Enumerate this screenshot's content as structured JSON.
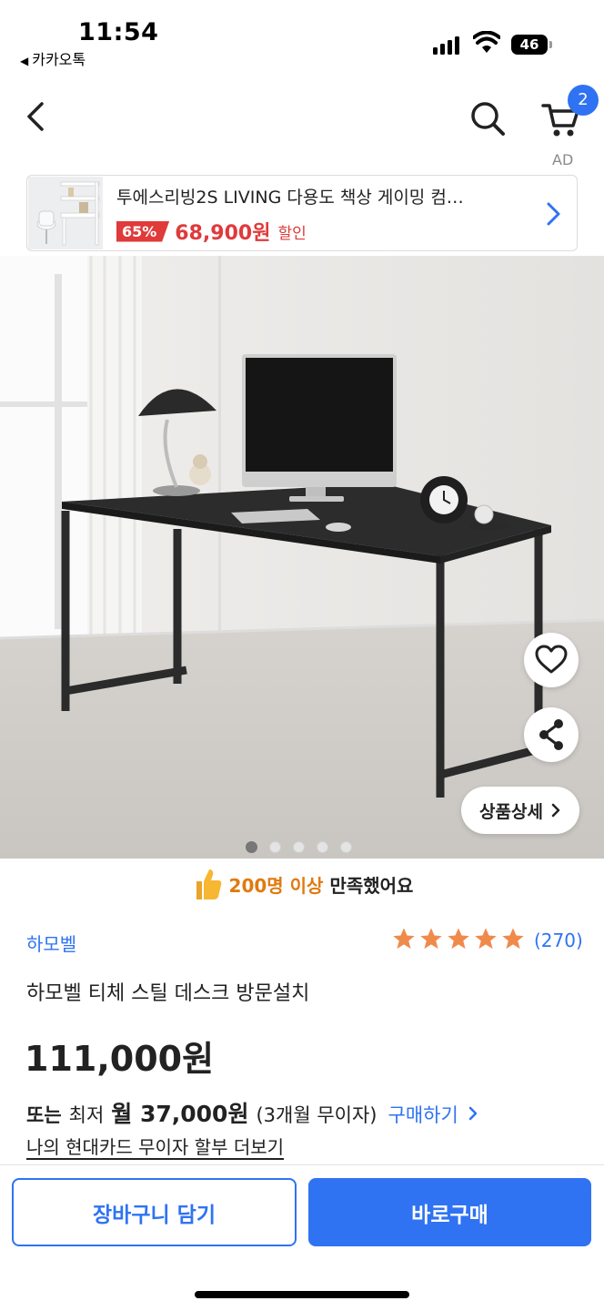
{
  "status_bar": {
    "time": "11:54",
    "back_app": "카카오톡",
    "battery": "46"
  },
  "nav": {
    "cart_count": "2"
  },
  "ad": {
    "label": "AD",
    "title": "투에스리빙2S LIVING 다용도 책상 게이밍 컴…",
    "discount": "65%",
    "price": "68,900원",
    "sale_label": "할인"
  },
  "hero": {
    "detail_button": "상품상세",
    "page_indicator": {
      "total": 5,
      "current": 1
    }
  },
  "satisfaction": {
    "highlight": "200명 이상",
    "rest": "만족했어요"
  },
  "product": {
    "brand": "하모벨",
    "rating_stars": 5,
    "review_count": "(270)",
    "name": "하모벨 티체 스틸 데스크 방문설치",
    "price": "111,000원"
  },
  "installment": {
    "prefix": "또는",
    "lowest": "최저",
    "monthly": "월 37,000원",
    "term": "(3개월 무이자)",
    "buy_link": "구매하기"
  },
  "card_link": "나의 현대카드 무이자 할부 더보기",
  "buttons": {
    "add_to_cart": "장바구니 담기",
    "buy_now": "바로구매"
  },
  "colors": {
    "accent": "#2f73f3",
    "sale": "#e03a3a",
    "highlight": "#e07a10",
    "star": "#f08a4b"
  }
}
